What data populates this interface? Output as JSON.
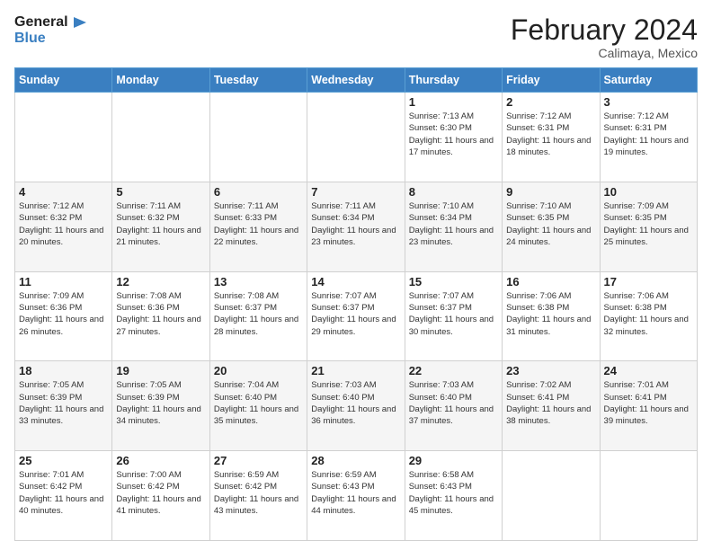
{
  "header": {
    "logo_general": "General",
    "logo_blue": "Blue",
    "month_title": "February 2024",
    "location": "Calimaya, Mexico"
  },
  "days_of_week": [
    "Sunday",
    "Monday",
    "Tuesday",
    "Wednesday",
    "Thursday",
    "Friday",
    "Saturday"
  ],
  "weeks": [
    [
      {
        "day": "",
        "info": ""
      },
      {
        "day": "",
        "info": ""
      },
      {
        "day": "",
        "info": ""
      },
      {
        "day": "",
        "info": ""
      },
      {
        "day": "1",
        "info": "Sunrise: 7:13 AM\nSunset: 6:30 PM\nDaylight: 11 hours and 17 minutes."
      },
      {
        "day": "2",
        "info": "Sunrise: 7:12 AM\nSunset: 6:31 PM\nDaylight: 11 hours and 18 minutes."
      },
      {
        "day": "3",
        "info": "Sunrise: 7:12 AM\nSunset: 6:31 PM\nDaylight: 11 hours and 19 minutes."
      }
    ],
    [
      {
        "day": "4",
        "info": "Sunrise: 7:12 AM\nSunset: 6:32 PM\nDaylight: 11 hours and 20 minutes."
      },
      {
        "day": "5",
        "info": "Sunrise: 7:11 AM\nSunset: 6:32 PM\nDaylight: 11 hours and 21 minutes."
      },
      {
        "day": "6",
        "info": "Sunrise: 7:11 AM\nSunset: 6:33 PM\nDaylight: 11 hours and 22 minutes."
      },
      {
        "day": "7",
        "info": "Sunrise: 7:11 AM\nSunset: 6:34 PM\nDaylight: 11 hours and 23 minutes."
      },
      {
        "day": "8",
        "info": "Sunrise: 7:10 AM\nSunset: 6:34 PM\nDaylight: 11 hours and 23 minutes."
      },
      {
        "day": "9",
        "info": "Sunrise: 7:10 AM\nSunset: 6:35 PM\nDaylight: 11 hours and 24 minutes."
      },
      {
        "day": "10",
        "info": "Sunrise: 7:09 AM\nSunset: 6:35 PM\nDaylight: 11 hours and 25 minutes."
      }
    ],
    [
      {
        "day": "11",
        "info": "Sunrise: 7:09 AM\nSunset: 6:36 PM\nDaylight: 11 hours and 26 minutes."
      },
      {
        "day": "12",
        "info": "Sunrise: 7:08 AM\nSunset: 6:36 PM\nDaylight: 11 hours and 27 minutes."
      },
      {
        "day": "13",
        "info": "Sunrise: 7:08 AM\nSunset: 6:37 PM\nDaylight: 11 hours and 28 minutes."
      },
      {
        "day": "14",
        "info": "Sunrise: 7:07 AM\nSunset: 6:37 PM\nDaylight: 11 hours and 29 minutes."
      },
      {
        "day": "15",
        "info": "Sunrise: 7:07 AM\nSunset: 6:37 PM\nDaylight: 11 hours and 30 minutes."
      },
      {
        "day": "16",
        "info": "Sunrise: 7:06 AM\nSunset: 6:38 PM\nDaylight: 11 hours and 31 minutes."
      },
      {
        "day": "17",
        "info": "Sunrise: 7:06 AM\nSunset: 6:38 PM\nDaylight: 11 hours and 32 minutes."
      }
    ],
    [
      {
        "day": "18",
        "info": "Sunrise: 7:05 AM\nSunset: 6:39 PM\nDaylight: 11 hours and 33 minutes."
      },
      {
        "day": "19",
        "info": "Sunrise: 7:05 AM\nSunset: 6:39 PM\nDaylight: 11 hours and 34 minutes."
      },
      {
        "day": "20",
        "info": "Sunrise: 7:04 AM\nSunset: 6:40 PM\nDaylight: 11 hours and 35 minutes."
      },
      {
        "day": "21",
        "info": "Sunrise: 7:03 AM\nSunset: 6:40 PM\nDaylight: 11 hours and 36 minutes."
      },
      {
        "day": "22",
        "info": "Sunrise: 7:03 AM\nSunset: 6:40 PM\nDaylight: 11 hours and 37 minutes."
      },
      {
        "day": "23",
        "info": "Sunrise: 7:02 AM\nSunset: 6:41 PM\nDaylight: 11 hours and 38 minutes."
      },
      {
        "day": "24",
        "info": "Sunrise: 7:01 AM\nSunset: 6:41 PM\nDaylight: 11 hours and 39 minutes."
      }
    ],
    [
      {
        "day": "25",
        "info": "Sunrise: 7:01 AM\nSunset: 6:42 PM\nDaylight: 11 hours and 40 minutes."
      },
      {
        "day": "26",
        "info": "Sunrise: 7:00 AM\nSunset: 6:42 PM\nDaylight: 11 hours and 41 minutes."
      },
      {
        "day": "27",
        "info": "Sunrise: 6:59 AM\nSunset: 6:42 PM\nDaylight: 11 hours and 43 minutes."
      },
      {
        "day": "28",
        "info": "Sunrise: 6:59 AM\nSunset: 6:43 PM\nDaylight: 11 hours and 44 minutes."
      },
      {
        "day": "29",
        "info": "Sunrise: 6:58 AM\nSunset: 6:43 PM\nDaylight: 11 hours and 45 minutes."
      },
      {
        "day": "",
        "info": ""
      },
      {
        "day": "",
        "info": ""
      }
    ]
  ]
}
